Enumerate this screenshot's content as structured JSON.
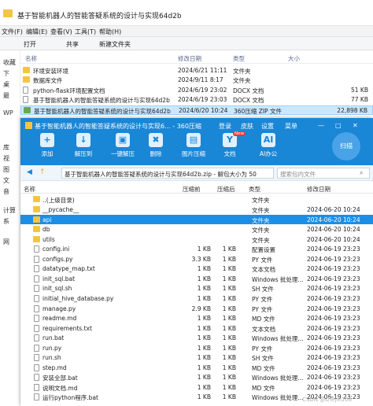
{
  "explorer": {
    "title": "基于智能机器人的智能答疑系统的设计与实现64d2b",
    "menu": [
      "文件(F)",
      "编辑(E)",
      "查看(V)",
      "工具(T)",
      "帮助(H)"
    ],
    "toolbar": [
      "打开",
      "共享",
      "新建文件夹"
    ],
    "columns": [
      "名称",
      "修改日期",
      "类型",
      "大小"
    ],
    "nav": [
      "收藏",
      "下",
      "桌",
      "最",
      "WP",
      "库",
      "视",
      "图",
      "文",
      "音",
      "计算",
      "系",
      "网"
    ],
    "rows": [
      {
        "name": "环境安装环境",
        "date": "2024/6/21 11:11",
        "type": "文件夹",
        "size": ""
      },
      {
        "name": "数据库文件",
        "date": "2024/9/11 8:17",
        "type": "文件夹",
        "size": ""
      },
      {
        "name": "python-flask环境配置文档",
        "date": "2024/6/19 23:02",
        "type": "DOCX 文档",
        "size": "51 KB"
      },
      {
        "name": "基于智能机器人的智能答疑系统的设计与实现64d2b",
        "date": "2024/6/19 23:03",
        "type": "DOCX 文档",
        "size": "77 KB"
      },
      {
        "name": "基于智能机器人的智能答疑系统的设计与实现64d2b",
        "date": "2024/6/20 10:24",
        "type": "360压缩 ZIP 文件",
        "size": "22,898 KB"
      }
    ]
  },
  "w360": {
    "title": "基于智能机器人的智能答疑系统的设计与实现6... - 360压缩",
    "title_menus": [
      "登录",
      "皮肤",
      "设置",
      "菜单"
    ],
    "tools": [
      "添加",
      "解压到",
      "一键解压",
      "删除",
      "图片压缩",
      "文档",
      "AI办公"
    ],
    "tools_icons": [
      "plus-icon",
      "extract-icon",
      "one-click-icon",
      "delete-icon",
      "image-compress-icon",
      "document-icon",
      "ai-office-icon"
    ],
    "new_badge": "New",
    "scan_label": "扫描",
    "path": "基于智能机器人的智能答疑系统的设计与实现64d2b.zip - 解包大小为 50",
    "search_placeholder": "搜索包内文件",
    "columns": [
      "名称",
      "压缩前",
      "压缩后",
      "类型",
      "修改日期"
    ],
    "up_folder": "..(上级目录)",
    "up_folder_type": "文件夹",
    "files": [
      {
        "name": "__pycache__",
        "before": "",
        "after": "",
        "type": "文件夹",
        "date": "2024-06-20 10:24",
        "kind": "folder"
      },
      {
        "name": "api",
        "before": "",
        "after": "",
        "type": "文件夹",
        "date": "2024-06-20 10:24",
        "kind": "folder"
      },
      {
        "name": "db",
        "before": "",
        "after": "",
        "type": "文件夹",
        "date": "2024-06-20 10:24",
        "kind": "folder"
      },
      {
        "name": "utils",
        "before": "",
        "after": "",
        "type": "文件夹",
        "date": "2024-06-20 10:24",
        "kind": "folder"
      },
      {
        "name": "config.ini",
        "before": "1 KB",
        "after": "1 KB",
        "type": "配置设置",
        "date": "2024-06-19 23:23",
        "kind": "file"
      },
      {
        "name": "configs.py",
        "before": "3.3 KB",
        "after": "1 KB",
        "type": "PY 文件",
        "date": "2024-06-19 23:23",
        "kind": "file"
      },
      {
        "name": "datatype_map.txt",
        "before": "1 KB",
        "after": "1 KB",
        "type": "文本文档",
        "date": "2024-06-19 23:23",
        "kind": "file"
      },
      {
        "name": "init_sql.bat",
        "before": "1 KB",
        "after": "1 KB",
        "type": "Windows 批处理...",
        "date": "2024-06-19 23:23",
        "kind": "file"
      },
      {
        "name": "init_sql.sh",
        "before": "1 KB",
        "after": "1 KB",
        "type": "SH 文件",
        "date": "2024-06-19 23:23",
        "kind": "file"
      },
      {
        "name": "initial_hive_database.py",
        "before": "1 KB",
        "after": "1 KB",
        "type": "PY 文件",
        "date": "2024-06-19 23:23",
        "kind": "file"
      },
      {
        "name": "manage.py",
        "before": "2.9 KB",
        "after": "1 KB",
        "type": "PY 文件",
        "date": "2024-06-19 23:23",
        "kind": "file"
      },
      {
        "name": "readme.md",
        "before": "1 KB",
        "after": "1 KB",
        "type": "MD 文件",
        "date": "2024-06-19 23:23",
        "kind": "file"
      },
      {
        "name": "requirements.txt",
        "before": "1 KB",
        "after": "1 KB",
        "type": "文本文档",
        "date": "2024-06-19 23:23",
        "kind": "file"
      },
      {
        "name": "run.bat",
        "before": "1 KB",
        "after": "1 KB",
        "type": "Windows 批处理...",
        "date": "2024-06-19 23:23",
        "kind": "file"
      },
      {
        "name": "run.py",
        "before": "1 KB",
        "after": "1 KB",
        "type": "PY 文件",
        "date": "2024-06-19 23:23",
        "kind": "file"
      },
      {
        "name": "run.sh",
        "before": "1 KB",
        "after": "1 KB",
        "type": "SH 文件",
        "date": "2024-06-19 23:23",
        "kind": "file"
      },
      {
        "name": "step.md",
        "before": "1 KB",
        "after": "1 KB",
        "type": "MD 文件",
        "date": "2024-06-19 23:23",
        "kind": "file"
      },
      {
        "name": "安装全部.bat",
        "before": "1 KB",
        "after": "1 KB",
        "type": "Windows 批处理...",
        "date": "2024-06-19 23:23",
        "kind": "file"
      },
      {
        "name": "说明文档.md",
        "before": "1 KB",
        "after": "1 KB",
        "type": "MD 文件",
        "date": "2024-06-19 23:23",
        "kind": "file"
      },
      {
        "name": "运行python程序.bat",
        "before": "1 KB",
        "after": "1 KB",
        "type": "Windows 批处理...",
        "date": "2024-06-19 23:23",
        "kind": "file"
      }
    ],
    "selected_index": 1,
    "watermark": "CSDN @shejie206"
  },
  "colors": {
    "accent": "#1a86d6",
    "selection": "#1c8ee6"
  }
}
